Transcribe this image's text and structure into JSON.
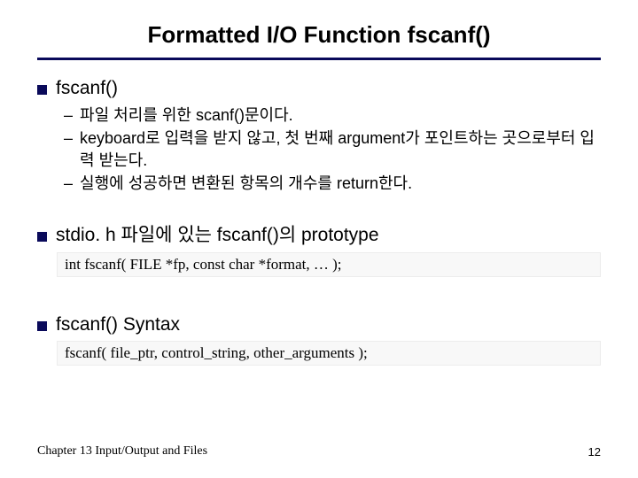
{
  "title": "Formatted I/O Function fscanf()",
  "sections": [
    {
      "head": "fscanf()",
      "items": [
        "파일 처리를 위한 scanf()문이다.",
        "keyboard로 입력을 받지 않고, 첫 번째 argument가 포인트하는 곳으로부터 입력 받는다.",
        "실행에 성공하면 변환된 항목의 개수를 return한다."
      ]
    },
    {
      "head": "stdio. h 파일에 있는 fscanf()의 prototype",
      "code": "int fscanf( FILE *fp, const char *format, … );"
    },
    {
      "head": "fscanf() Syntax",
      "code": "fscanf( file_ptr, control_string, other_arguments );"
    }
  ],
  "footer": {
    "chapter": "Chapter 13  Input/Output and Files",
    "page": "12"
  }
}
